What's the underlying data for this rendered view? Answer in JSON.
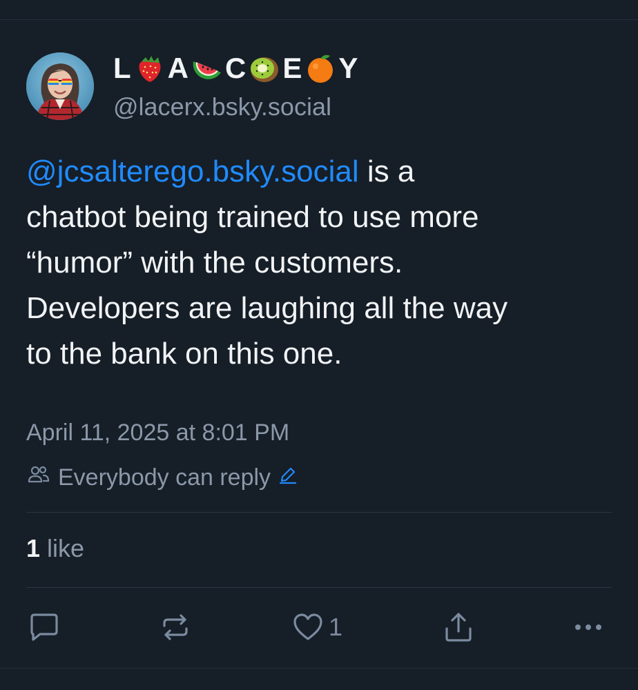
{
  "author": {
    "display_name_parts": [
      {
        "type": "letter",
        "text": "L"
      },
      {
        "type": "emoji",
        "name": "strawberry-emoji"
      },
      {
        "type": "letter",
        "text": "A"
      },
      {
        "type": "emoji",
        "name": "watermelon-emoji"
      },
      {
        "type": "letter",
        "text": "C"
      },
      {
        "type": "emoji",
        "name": "kiwi-emoji"
      },
      {
        "type": "letter",
        "text": "E"
      },
      {
        "type": "emoji",
        "name": "orange-emoji"
      },
      {
        "type": "letter",
        "text": "Y"
      }
    ],
    "handle": "@lacerx.bsky.social",
    "avatar": "avatar-photo"
  },
  "post": {
    "mention": "@jcsalterego.bsky.social",
    "text_line1_rest": " is a",
    "text_line2": "chatbot being trained to use more",
    "text_line3": "“humor” with the customers.",
    "text_line4": "Developers are laughing all the way",
    "text_line5": "to the bank on this one.",
    "timestamp": "April 11, 2025 at 8:01 PM",
    "reply_setting": "Everybody can reply"
  },
  "stats": {
    "likes_count": "1",
    "likes_label": " like"
  },
  "actions": {
    "reply_icon": "reply-icon",
    "repost_icon": "repost-icon",
    "like_icon": "heart-icon",
    "like_count": "1",
    "share_icon": "share-icon",
    "more_icon": "more-icon"
  },
  "colors": {
    "background": "#161e27",
    "text": "#f1f3f5",
    "muted": "#8b98a9",
    "link": "#208bfe"
  }
}
